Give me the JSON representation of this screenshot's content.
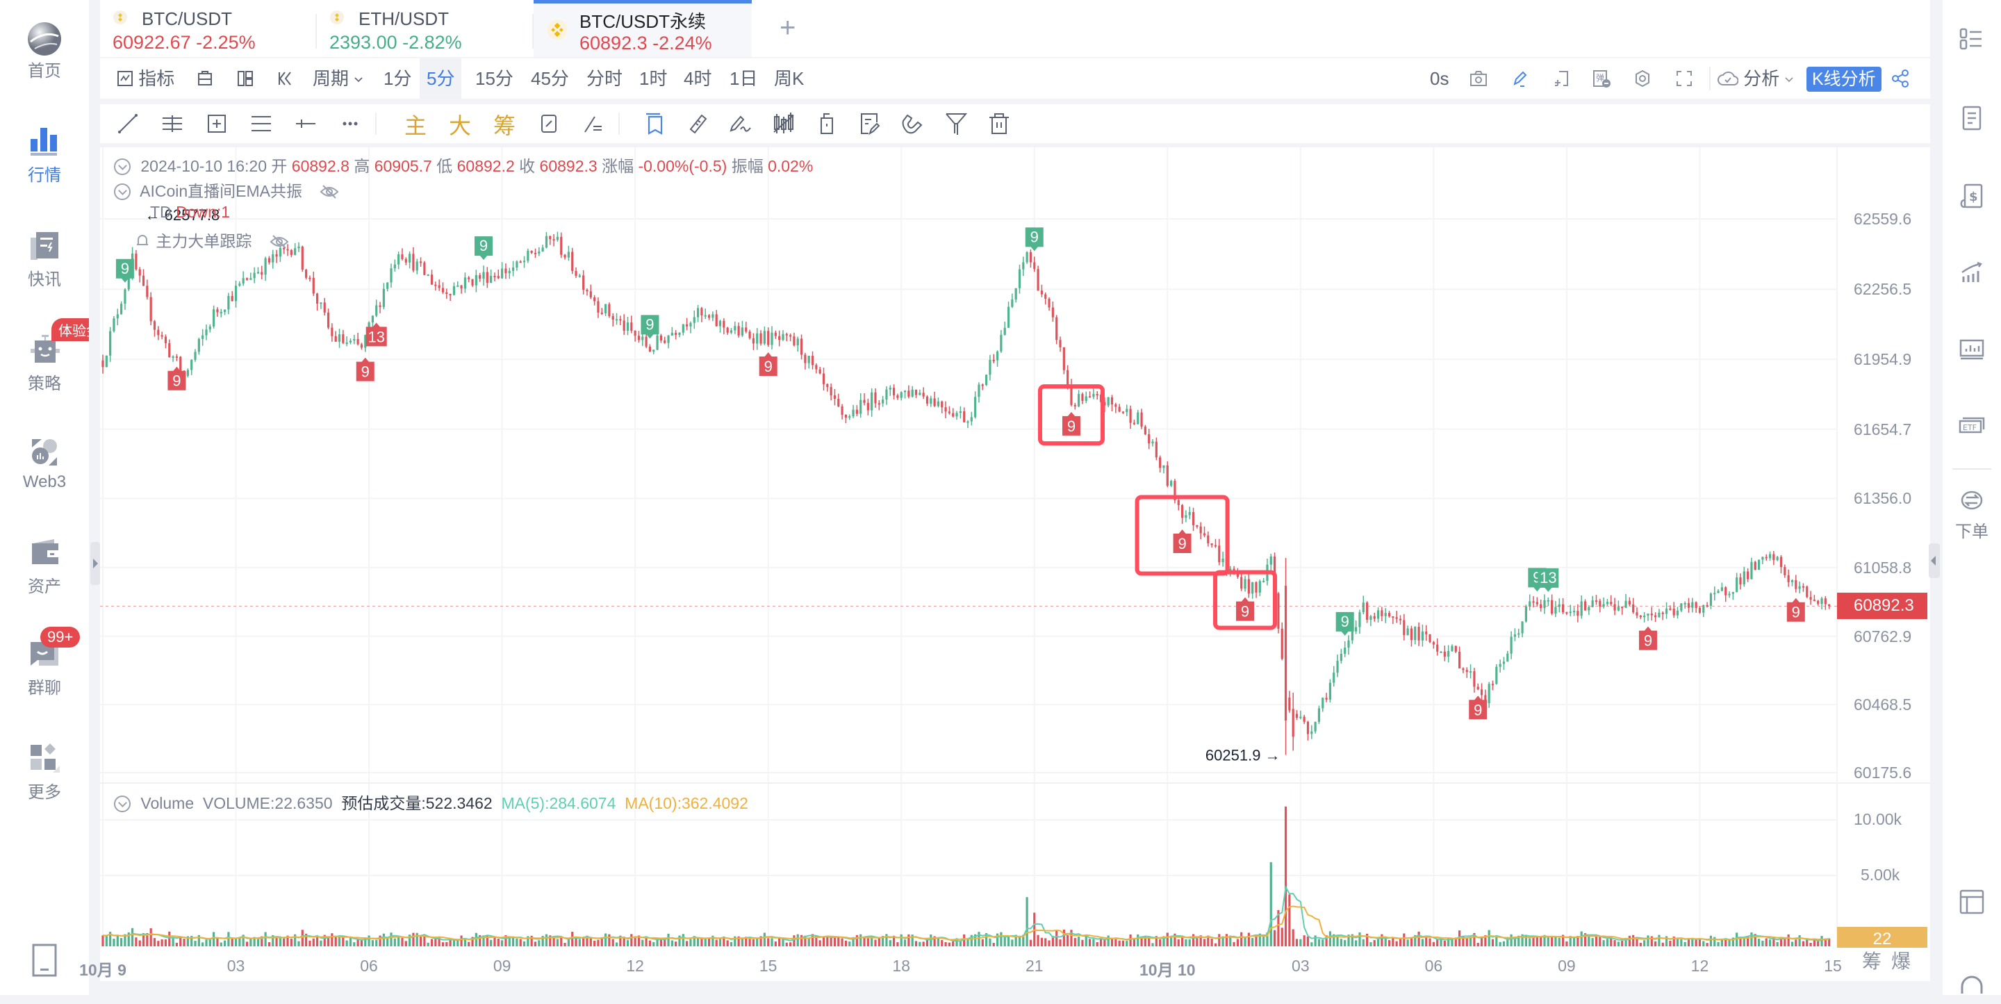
{
  "sidebar": {
    "items": [
      {
        "label": "首页",
        "icon": "globe-logo-icon"
      },
      {
        "label": "行情",
        "icon": "bar-chart-icon",
        "active": true
      },
      {
        "label": "快讯",
        "icon": "news-flash-icon"
      },
      {
        "label": "策略",
        "icon": "robot-icon",
        "badge": "体验金"
      },
      {
        "label": "Web3",
        "icon": "web3-icon"
      },
      {
        "label": "资产",
        "icon": "wallet-icon"
      },
      {
        "label": "群聊",
        "icon": "chat-icon",
        "badge": "99+"
      },
      {
        "label": "更多",
        "icon": "grid-more-icon"
      }
    ],
    "bottom_icon": "tablet-icon"
  },
  "tabs": [
    {
      "name": "BTC/USDT",
      "price": "60922.67",
      "change": "-2.25%",
      "color": "red"
    },
    {
      "name": "ETH/USDT",
      "price": "2393.00",
      "change": "-2.82%",
      "color": "green"
    },
    {
      "name": "BTC/USDT永续",
      "price": "60892.3",
      "change": "-2.24%",
      "color": "red",
      "active": true
    }
  ],
  "add_tab": "+",
  "toolbar": {
    "indicators": "指标",
    "period": "周期",
    "periods": [
      "1分",
      "5分",
      "15分",
      "45分",
      "分时",
      "1时",
      "4时",
      "1日",
      "周K"
    ],
    "selected_period": "5分",
    "timer": "0s",
    "analysis": "分析",
    "kline_analysis": "K线分析"
  },
  "drawing_toolbar": {
    "gold_buttons": [
      "主",
      "大",
      "筹"
    ]
  },
  "info": {
    "datetime": "2024-10-10 16:20",
    "open_label": "开",
    "open": "60892.8",
    "high_label": "高",
    "high": "60905.7",
    "low_label": "低",
    "low": "60892.2",
    "close_label": "收",
    "close": "60892.3",
    "change_label": "涨幅",
    "change": "-0.00%(-0.5)",
    "amplitude_label": "振幅",
    "amplitude": "0.02%"
  },
  "indicators": [
    {
      "name": "AICoin直播间EMA共振"
    },
    {
      "name": "TD",
      "value": "Down:1"
    },
    {
      "name": "主力大单跟踪"
    }
  ],
  "volume_info": {
    "title": "Volume",
    "volume": "VOLUME:22.6350",
    "estimate": "预估成交量:522.3462",
    "ma5": "MA(5):284.6074",
    "ma10": "MA(10):362.4092"
  },
  "colors": {
    "up": "#4fb38d",
    "down": "#e0525a",
    "accent": "#4a86e8",
    "ma5": "#5fcfb2",
    "ma10": "#f0b03c",
    "highlight_box": "#ff4d5e"
  },
  "chart_data": {
    "type": "candlestick",
    "symbol": "BTC/USDT永续",
    "interval": "5分",
    "y_ticks": [
      62559.6,
      62256.5,
      61954.9,
      61654.7,
      61356.0,
      61058.8,
      60762.9,
      60468.5,
      60175.6
    ],
    "ylim": [
      60100,
      62700
    ],
    "current_price": "60892.3",
    "high_marker": "62577.8",
    "low_marker": "60251.9",
    "x_ticks": [
      "10月 9",
      "03",
      "06",
      "09",
      "12",
      "15",
      "18",
      "21",
      "10月 10",
      "03",
      "06",
      "09",
      "12",
      "15"
    ],
    "price_path": [
      [
        0,
        61950
      ],
      [
        8,
        62380
      ],
      [
        14,
        62100
      ],
      [
        22,
        61880
      ],
      [
        30,
        62150
      ],
      [
        40,
        62320
      ],
      [
        52,
        62450
      ],
      [
        62,
        62050
      ],
      [
        70,
        62000
      ],
      [
        80,
        62430
      ],
      [
        92,
        62250
      ],
      [
        100,
        62300
      ],
      [
        112,
        62350
      ],
      [
        122,
        62480
      ],
      [
        134,
        62190
      ],
      [
        148,
        62000
      ],
      [
        160,
        62150
      ],
      [
        172,
        62070
      ],
      [
        188,
        62020
      ],
      [
        200,
        61700
      ],
      [
        210,
        61800
      ],
      [
        220,
        61820
      ],
      [
        234,
        61700
      ],
      [
        244,
        62100
      ],
      [
        250,
        62420
      ],
      [
        258,
        62060
      ],
      [
        262,
        61770
      ],
      [
        270,
        61780
      ],
      [
        280,
        61700
      ],
      [
        286,
        61500
      ],
      [
        292,
        61300
      ],
      [
        298,
        61220
      ],
      [
        304,
        61050
      ],
      [
        312,
        60950
      ],
      [
        316,
        61100
      ],
      [
        320,
        60500
      ],
      [
        326,
        60350
      ],
      [
        336,
        60700
      ],
      [
        340,
        60880
      ],
      [
        346,
        60840
      ],
      [
        354,
        60780
      ],
      [
        366,
        60680
      ],
      [
        374,
        60500
      ],
      [
        386,
        60900
      ],
      [
        398,
        60880
      ],
      [
        410,
        60900
      ],
      [
        420,
        60860
      ],
      [
        434,
        60900
      ],
      [
        446,
        61050
      ],
      [
        452,
        61100
      ],
      [
        458,
        60970
      ],
      [
        466,
        60900
      ]
    ],
    "td_markers": [
      {
        "i": 6,
        "label": "9",
        "type": "up"
      },
      {
        "i": 20,
        "label": "9",
        "type": "down"
      },
      {
        "i": 71,
        "label": "9",
        "type": "down"
      },
      {
        "i": 74,
        "label": "13",
        "type": "down"
      },
      {
        "i": 103,
        "label": "9",
        "type": "up"
      },
      {
        "i": 148,
        "label": "9",
        "type": "up"
      },
      {
        "i": 180,
        "label": "9",
        "type": "down"
      },
      {
        "i": 252,
        "label": "9",
        "type": "up"
      },
      {
        "i": 262,
        "label": "9",
        "type": "down"
      },
      {
        "i": 292,
        "label": "9",
        "type": "down"
      },
      {
        "i": 309,
        "label": "9",
        "type": "down"
      },
      {
        "i": 336,
        "label": "9",
        "type": "up"
      },
      {
        "i": 372,
        "label": "9",
        "type": "down"
      },
      {
        "i": 388,
        "label": "9",
        "type": "up"
      },
      {
        "i": 391,
        "label": "13",
        "type": "up"
      },
      {
        "i": 418,
        "label": "9",
        "type": "down"
      },
      {
        "i": 458,
        "label": "9",
        "type": "down"
      }
    ],
    "highlight_boxes": [
      262,
      292,
      309
    ],
    "volume": {
      "y_ticks": [
        "10.00k",
        "5.00k"
      ],
      "ylim": [
        0,
        11000
      ],
      "current": "22"
    },
    "volume_axis_buttons": [
      "筹",
      "爆"
    ]
  }
}
